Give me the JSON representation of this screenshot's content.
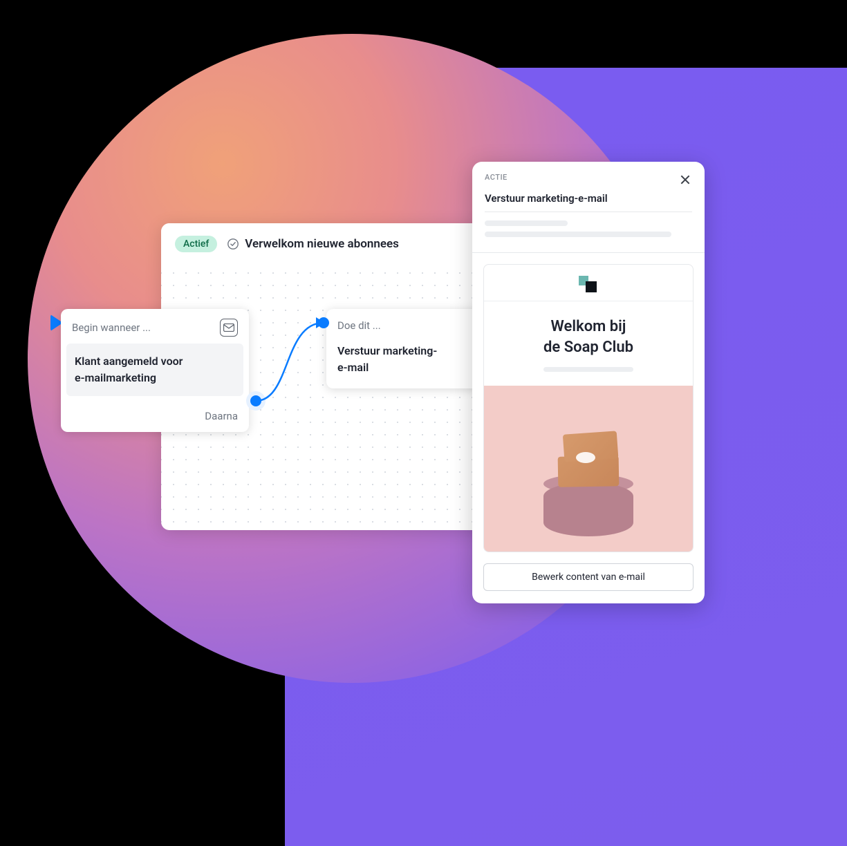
{
  "canvas": {
    "status_label": "Actief",
    "title": "Verwelkom nieuwe abonnees"
  },
  "trigger": {
    "top_label": "Begin wanneer ...",
    "body_line1": "Klant aangemeld voor",
    "body_line2": "e-mailmarketing",
    "footer_label": "Daarna"
  },
  "action": {
    "top_label": "Doe dit ...",
    "body_line1": "Verstuur marketing-",
    "body_line2": "e-mail"
  },
  "panel": {
    "eyebrow": "ACTIE",
    "title": "Verstuur marketing-e-mail",
    "email_headline_line1": "Welkom bij",
    "email_headline_line2": "de Soap Club",
    "edit_button": "Bewerk content van e-mail"
  },
  "colors": {
    "accent_blue": "#0a7cff",
    "status_bg": "#c5f0df",
    "status_text": "#0e6b47"
  }
}
